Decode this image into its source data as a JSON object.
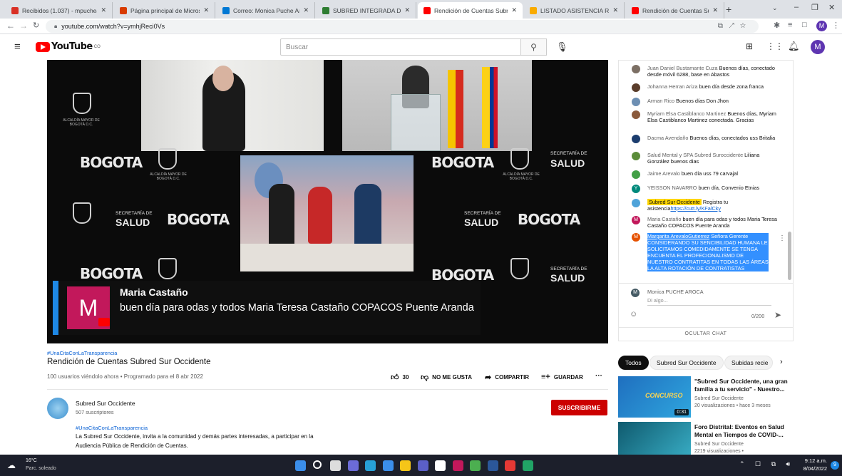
{
  "browser": {
    "tabs": [
      {
        "label": "Recibidos (1.037) - mpuchearoc",
        "color": "#d93025",
        "icon": "gmail-icon"
      },
      {
        "label": "Página principal de Microsoft Of",
        "color": "#d83b01",
        "icon": "office-icon"
      },
      {
        "label": "Correo: Monica Puche Aroca - C",
        "color": "#0078d4",
        "icon": "outlook-icon"
      },
      {
        "label": "SUBRED INTEGRADA DE SERVIC",
        "color": "#2e7d32",
        "icon": "subred-icon"
      },
      {
        "label": "Rendición de Cuentas Subr",
        "color": "#ff0000",
        "icon": "youtube-icon",
        "active": true
      },
      {
        "label": "LISTADO ASISTENCIA RENDICIO",
        "color": "#f9ab00",
        "icon": "sheets-icon"
      },
      {
        "label": "Rendición de Cuentas Subred S",
        "color": "#ff0000",
        "icon": "youtube-icon"
      }
    ],
    "url": "youtube.com/watch?v=ymhjReci0Vs"
  },
  "youtube": {
    "logo": "YouTube",
    "logo_sup": "CO",
    "search_placeholder": "Buscar",
    "avatar_letter": "M"
  },
  "player": {
    "lower_third_initial": "M",
    "lower_third_name": "Maria Castaño",
    "lower_third_message": "buen día para odas y todos Maria Teresa Castaño COPACOS Puente Aranda",
    "bg_bogota": "BOGOTA",
    "bg_secretaria": "SECRETARÍA DE",
    "bg_salud": "SALUD",
    "bg_alcaldia": "ALCALDÍA MAYOR DE BOGOTÁ D.C."
  },
  "chat": {
    "messages": [
      {
        "author": "Juan Daniel Bustamante Cuza",
        "text": "Buenos días, conectado desde móvil 6288, base en Abastos",
        "color": "#7c6f64"
      },
      {
        "author": "Johanna Herran Ariza",
        "text": "buen día desde zona franca",
        "color": "#5a3d2b"
      },
      {
        "author": "Arman Rico",
        "text": "Buenos días Don Jhon",
        "color": "#6d8fb3"
      },
      {
        "author": "Myriam Elsa Castiblanco Martinez",
        "text": "Buenos días, Myriam Elsa Castiblanco Martinez conectada. Gracias",
        "color": "#8a5a3c"
      },
      {
        "author": "Dacma Avendaño",
        "text": "Buenos días, conectados uss Britalia",
        "color": "#1c3d6e"
      },
      {
        "author": "Salud Mental y SPA Subred Suroccidente",
        "text": "Liliana González buenos dias",
        "color": "#5b8c3a"
      },
      {
        "author": "Jaime Arevalo",
        "text": "buen día uss 79 carvajal",
        "color": "#43a047"
      },
      {
        "author": "YEISSON NAVARRO",
        "text": "buen día, Convenio Etnias",
        "color": "#00897b",
        "initial": "Y"
      },
      {
        "author": "Subred Sur Occidente",
        "text": "Registra tu asistencia",
        "link": "https://cutt.ly/KFalCky",
        "color": "#4fa3d9",
        "owner": true
      },
      {
        "author": "Maria Castaño",
        "text": "buen día para odas y todos Maria Teresa Castaño COPACOS Puente Aranda",
        "color": "#c2185b",
        "initial": "M"
      },
      {
        "author": "Margarita ArevaloGutierrez",
        "text": "Señora Gerente CONSIDERANDO SU SENCIBILIDAD HUMANA LE SOLICITAMOS COMEDIDAMENTE SE TENGA ENCUENTA EL PROFECIONALISMO DE NUESTRO CONTRATITAS EN TODAS LAS ÁREAS LA ALTA ROTACIÓN DE CONTRATISTAS",
        "color": "#e65100",
        "initial": "M",
        "selected": true
      }
    ],
    "current_user": "Monica PUCHE AROCA",
    "input_placeholder": "Di algo...",
    "char_count": "0/200",
    "hide_chat": "OCULTAR CHAT"
  },
  "video": {
    "hashtag": "#UnaCitaConLaTransparencia",
    "title": "Rendición de Cuentas Subred Sur Occidente",
    "meta": "100 usuarios viéndolo ahora • Programado para el 8 abr 2022",
    "likes": "30",
    "dislike_label": "NO ME GUSTA",
    "share_label": "COMPARTIR",
    "save_label": "GUARDAR",
    "more": "···"
  },
  "channel": {
    "name": "Subred Sur Occidente",
    "subscribers": "507 suscriptores",
    "subscribe_label": "SUSCRIBIRME",
    "desc_hashtag": "#UnaCitaConLaTransparencia",
    "desc_line1": "La Subred Sur Occidente, invita a la comunidad y demás partes interesadas, a participar en la",
    "desc_line2": "Audiencia Pública de Rendición de Cuentas."
  },
  "recs": {
    "chips": [
      "Todos",
      "Subred Sur Occidente",
      "Subidas recie"
    ],
    "items": [
      {
        "title": "\"Subred Sur Occidente, una gran familia a tu servicio\" - Nuestro...",
        "channel": "Subred Sur Occidente",
        "meta": "20 visualizaciones • hace 3 meses",
        "duration": "0:31",
        "thumb_text": "CONCURSO"
      },
      {
        "title": "Foro Distrital: Eventos en Salud Mental en Tiempos de COVID-...",
        "channel": "Subred Sur Occidente",
        "meta": "2219 visualizaciones •",
        "duration": "",
        "thumb_text": ""
      }
    ]
  },
  "taskbar": {
    "weather_temp": "16°C",
    "weather_desc": "Parc. soleado",
    "time": "9:12 a.m.",
    "date": "8/04/2022"
  }
}
